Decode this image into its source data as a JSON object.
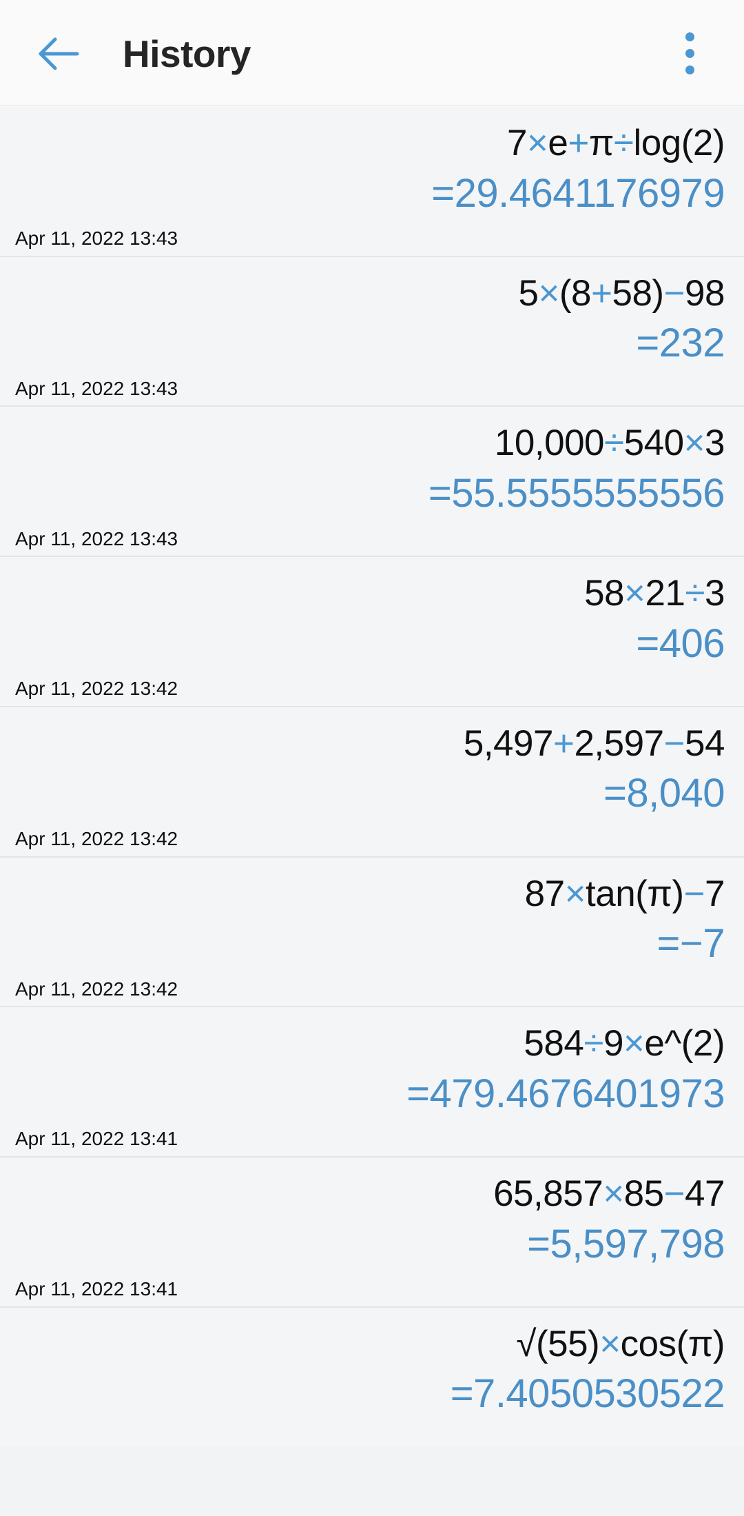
{
  "header": {
    "title": "History",
    "back_icon": "arrow-left-icon",
    "overflow_icon": "more-vertical-icon",
    "accent_color": "#4a97d2",
    "title_color": "#252525"
  },
  "colors": {
    "operator_blue": "#4a97d2",
    "result_blue": "#4a8fc7",
    "expression_black": "#111111",
    "row_background": "#f4f5f6",
    "divider": "#e2e5e8",
    "appbar_background": "#fafafa"
  },
  "history": {
    "items": [
      {
        "expression": "7×e+π÷log(2)",
        "expression_parts": [
          {
            "t": "7",
            "op": false
          },
          {
            "t": "×",
            "op": true
          },
          {
            "t": "e",
            "op": false
          },
          {
            "t": "+",
            "op": true
          },
          {
            "t": "π",
            "op": false
          },
          {
            "t": "÷",
            "op": true
          },
          {
            "t": "log(2)",
            "op": false
          }
        ],
        "result": "=29.4641176979",
        "timestamp": "Apr 11, 2022 13:43"
      },
      {
        "expression": "5×(8+58)−98",
        "expression_parts": [
          {
            "t": "5",
            "op": false
          },
          {
            "t": "×",
            "op": true
          },
          {
            "t": "(8",
            "op": false
          },
          {
            "t": "+",
            "op": true
          },
          {
            "t": "58)",
            "op": false
          },
          {
            "t": "−",
            "op": true
          },
          {
            "t": "98",
            "op": false
          }
        ],
        "result": "=232",
        "timestamp": "Apr 11, 2022 13:43"
      },
      {
        "expression": "10,000÷540×3",
        "expression_parts": [
          {
            "t": "10,000",
            "op": false
          },
          {
            "t": "÷",
            "op": true
          },
          {
            "t": "540",
            "op": false
          },
          {
            "t": "×",
            "op": true
          },
          {
            "t": "3",
            "op": false
          }
        ],
        "result": "=55.5555555556",
        "timestamp": "Apr 11, 2022 13:43"
      },
      {
        "expression": "58×21÷3",
        "expression_parts": [
          {
            "t": "58",
            "op": false
          },
          {
            "t": "×",
            "op": true
          },
          {
            "t": "21",
            "op": false
          },
          {
            "t": "÷",
            "op": true
          },
          {
            "t": "3",
            "op": false
          }
        ],
        "result": "=406",
        "timestamp": "Apr 11, 2022 13:42"
      },
      {
        "expression": "5,497+2,597−54",
        "expression_parts": [
          {
            "t": "5,497",
            "op": false
          },
          {
            "t": "+",
            "op": true
          },
          {
            "t": "2,597",
            "op": false
          },
          {
            "t": "−",
            "op": true
          },
          {
            "t": "54",
            "op": false
          }
        ],
        "result": "=8,040",
        "timestamp": "Apr 11, 2022 13:42"
      },
      {
        "expression": "87×tan(π)−7",
        "expression_parts": [
          {
            "t": "87",
            "op": false
          },
          {
            "t": "×",
            "op": true
          },
          {
            "t": "tan(π)",
            "op": false
          },
          {
            "t": "−",
            "op": true
          },
          {
            "t": "7",
            "op": false
          }
        ],
        "result": "=−7",
        "timestamp": "Apr 11, 2022 13:42"
      },
      {
        "expression": "584÷9×e^(2)",
        "expression_parts": [
          {
            "t": "584",
            "op": false
          },
          {
            "t": "÷",
            "op": true
          },
          {
            "t": "9",
            "op": false
          },
          {
            "t": "×",
            "op": true
          },
          {
            "t": "e^(2)",
            "op": false
          }
        ],
        "result": "=479.4676401973",
        "timestamp": "Apr 11, 2022 13:41"
      },
      {
        "expression": "65,857×85−47",
        "expression_parts": [
          {
            "t": "65,857",
            "op": false
          },
          {
            "t": "×",
            "op": true
          },
          {
            "t": "85",
            "op": false
          },
          {
            "t": "−",
            "op": true
          },
          {
            "t": "47",
            "op": false
          }
        ],
        "result": "=5,597,798",
        "timestamp": "Apr 11, 2022 13:41"
      },
      {
        "expression": "√(55)×cos(π)",
        "expression_parts": [
          {
            "t": "√(55)",
            "op": false
          },
          {
            "t": "×",
            "op": true
          },
          {
            "t": "cos(π)",
            "op": false
          }
        ],
        "result": "=7.4050530522",
        "timestamp": ""
      }
    ]
  }
}
